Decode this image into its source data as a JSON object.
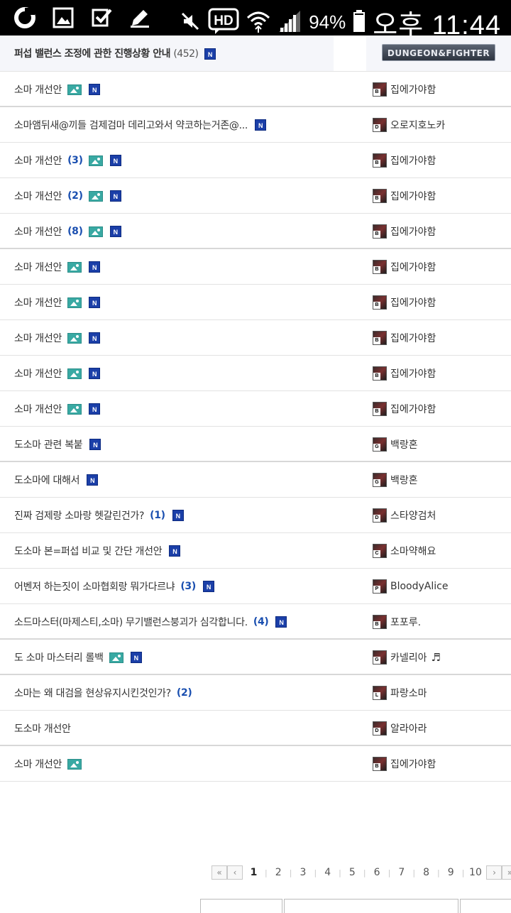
{
  "status_bar": {
    "battery": "94%",
    "clock": "오후 11:44",
    "icons": [
      "app-icon",
      "gallery-icon",
      "checkbox-icon",
      "pencil-icon",
      "mute-icon",
      "hd-call-icon",
      "wifi-icon",
      "signal-icon",
      "battery-icon"
    ]
  },
  "notice": {
    "title": "퍼섭 밸런스 조정에 관한 진행상황 안내",
    "count": "(452)",
    "new_badge": "N"
  },
  "logo": {
    "text": "DUNGEON&FIGHTER"
  },
  "posts": [
    {
      "title": "소마 개선안",
      "count": "",
      "image": true,
      "new": true,
      "author": "집에가야함",
      "level": "B"
    },
    {
      "title": "소마앰뒤새@끼들 검제검마 데리고와서 약코하는거존@...",
      "count": "",
      "image": false,
      "new": true,
      "author": "오로지호노카",
      "level": "D"
    },
    {
      "title": "소마 개선안",
      "count": "(3)",
      "image": true,
      "new": true,
      "author": "집에가야함",
      "level": "B"
    },
    {
      "title": "소마 개선안",
      "count": "(2)",
      "image": true,
      "new": true,
      "author": "집에가야함",
      "level": "B"
    },
    {
      "title": "소마 개선안",
      "count": "(8)",
      "image": true,
      "new": true,
      "author": "집에가야함",
      "level": "B"
    },
    {
      "title": "소마 개선안",
      "count": "",
      "image": true,
      "new": true,
      "author": "집에가야함",
      "level": "B"
    },
    {
      "title": "소마 개선안",
      "count": "",
      "image": true,
      "new": true,
      "author": "집에가야함",
      "level": "B"
    },
    {
      "title": "소마 개선안",
      "count": "",
      "image": true,
      "new": true,
      "author": "집에가야함",
      "level": "B"
    },
    {
      "title": "소마 개선안",
      "count": "",
      "image": true,
      "new": true,
      "author": "집에가야함",
      "level": "B"
    },
    {
      "title": "소마 개선안",
      "count": "",
      "image": true,
      "new": true,
      "author": "집에가야함",
      "level": "B"
    },
    {
      "title": "도소마 관련 복붙",
      "count": "",
      "image": false,
      "new": true,
      "author": "백랑혼",
      "level": "G"
    },
    {
      "title": "도소마에 대해서",
      "count": "",
      "image": false,
      "new": true,
      "author": "백랑혼",
      "level": "G"
    },
    {
      "title": "진짜 검제랑 소마랑 헷갈린건가?",
      "count": "(1)",
      "image": false,
      "new": true,
      "author": "스타양검처",
      "level": "D"
    },
    {
      "title": "도소마 본=퍼섭 비교 및 간단 개선안",
      "count": "",
      "image": false,
      "new": true,
      "author": "소마약해요",
      "level": "C"
    },
    {
      "title": "어벤저 하는짓이 소마협회랑 뭐가다르냐",
      "count": "(3)",
      "image": false,
      "new": true,
      "author": "BloodyAlice",
      "level": "P"
    },
    {
      "title": "소드마스터(마제스티,소마) 무기밸런스붕괴가 심각합니다.",
      "count": "(4)",
      "image": false,
      "new": true,
      "author": "포포루.",
      "level": "B"
    },
    {
      "title": "도 소마 마스터리 롤백",
      "count": "",
      "image": true,
      "new": true,
      "author": "카넬리아",
      "level": "G",
      "author_icon": "music-note-icon"
    },
    {
      "title": "소마는 왜 대검을 현상유지시킨것인가?",
      "count": "(2)",
      "image": false,
      "new": false,
      "author": "파랑소마",
      "level": "L"
    },
    {
      "title": "도소마 개선안",
      "count": "",
      "image": false,
      "new": false,
      "author": "알라아라",
      "level": "D"
    },
    {
      "title": "소마 개선안",
      "count": "",
      "image": true,
      "new": false,
      "author": "집에가야함",
      "level": "B"
    }
  ],
  "pagination": {
    "first": "«",
    "prev": "‹",
    "next": "›",
    "last": "»",
    "pages": [
      "1",
      "2",
      "3",
      "4",
      "5",
      "6",
      "7",
      "8",
      "9",
      "10"
    ],
    "current": "1"
  }
}
